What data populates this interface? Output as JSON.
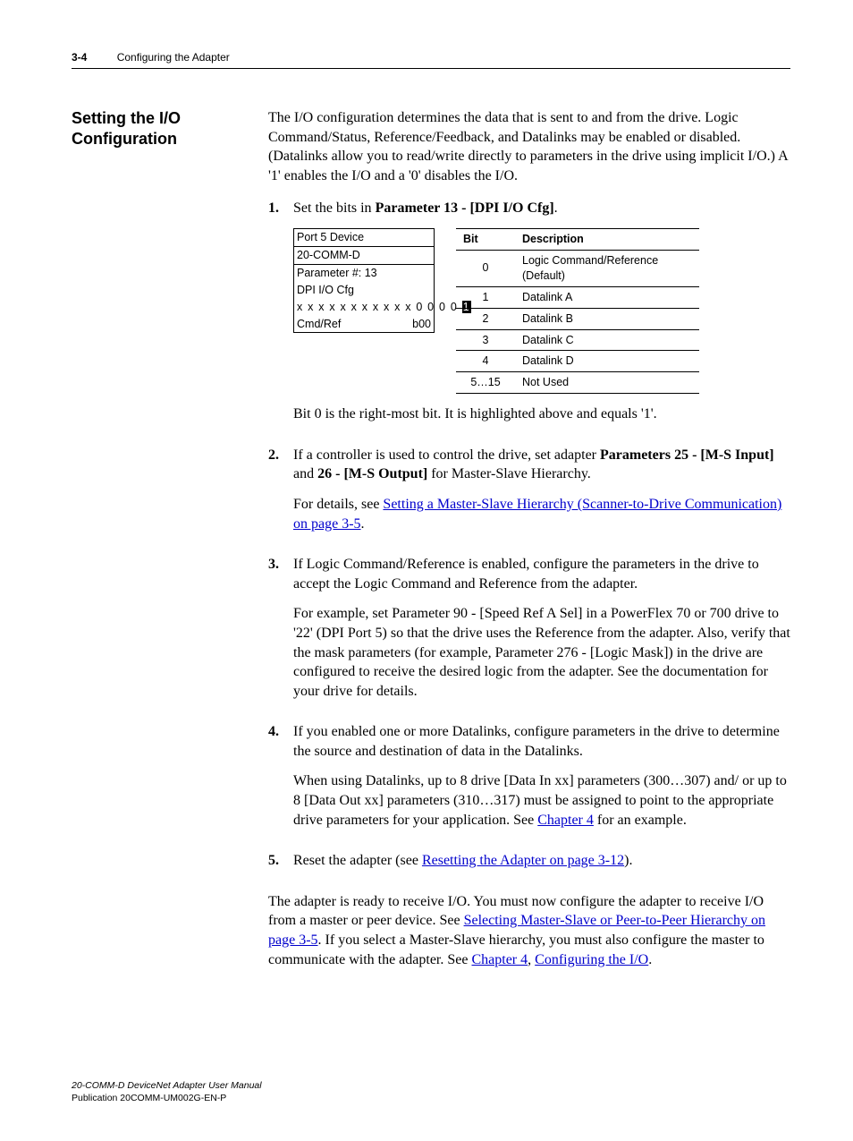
{
  "header": {
    "page": "3-4",
    "chapter": "Configuring the Adapter"
  },
  "side_heading": "Setting the I/O Configuration",
  "intro": "The I/O configuration determines the data that is sent to and from the drive. Logic Command/Status, Reference/Feedback, and Datalinks may be enabled or disabled. (Datalinks allow you to read/write directly to parameters in the drive using implicit I/O.) A '1' enables the I/O and a '0' disables the I/O.",
  "step1": {
    "num": "1.",
    "lead_a": "Set the bits in ",
    "lead_b": "Parameter 13 - [DPI I/O Cfg]",
    "lead_c": ".",
    "lcd": {
      "l1": "Port 5 Device",
      "l2": "20-COMM-D",
      "l3": "Parameter #: 13",
      "l4": "DPI I/O Cfg",
      "l5a": "x x x x x x x x x x x 0 0 0 0",
      "l5b": "1",
      "l6a": "Cmd/Ref",
      "l6b": "b00"
    },
    "table": {
      "h1": "Bit",
      "h2": "Description",
      "rows": [
        {
          "b": "0",
          "d": "Logic Command/Reference (Default)"
        },
        {
          "b": "1",
          "d": "Datalink A"
        },
        {
          "b": "2",
          "d": "Datalink B"
        },
        {
          "b": "3",
          "d": "Datalink C"
        },
        {
          "b": "4",
          "d": "Datalink D"
        },
        {
          "b": "5…15",
          "d": "Not Used"
        }
      ]
    },
    "after": "Bit 0 is the right-most bit. It is highlighted above and equals '1'."
  },
  "step2": {
    "num": "2.",
    "a": "If a controller is used to control the drive, set adapter ",
    "b": "Parameters 25 - [M-S Input]",
    "c": " and ",
    "d": "26 - [M-S Output]",
    "e": " for Master-Slave Hierarchy.",
    "f": "For details, see ",
    "link": "Setting a Master-Slave Hierarchy (Scanner-to-Drive Communication) on page 3-5",
    "g": "."
  },
  "step3": {
    "num": "3.",
    "p1": "If Logic Command/Reference is enabled, configure the parameters in the drive to accept the Logic Command and Reference from the adapter.",
    "p2": "For example, set Parameter 90 - [Speed Ref A Sel] in a PowerFlex 70 or 700 drive to '22' (DPI Port 5) so that the drive uses the Reference from the adapter. Also, verify that the mask parameters (for example, Parameter 276 - [Logic Mask]) in the drive are configured to receive the desired logic from the adapter. See the documentation for your drive for details."
  },
  "step4": {
    "num": "4.",
    "p1": "If you enabled one or more Datalinks, configure parameters in the drive to determine the source and destination of data in the Datalinks.",
    "p2a": "When using Datalinks, up to 8 drive [Data In xx] parameters (300…307) and/ or up to 8 [Data Out xx] parameters (310…317) must be assigned to point to the appropriate drive parameters for your application. See ",
    "p2link": "Chapter 4",
    "p2b": " for an example."
  },
  "step5": {
    "num": "5.",
    "a": "Reset the adapter (see ",
    "link": "Resetting the Adapter on page 3-12",
    "b": ")."
  },
  "closing": {
    "a": "The adapter is ready to receive I/O. You must now configure the adapter to receive I/O from a master or peer device. See ",
    "link1": "Selecting Master-Slave or Peer-to-Peer Hierarchy on page 3-5",
    "b": ". If you select a Master-Slave hierarchy, you must also configure the master to communicate with the adapter. See ",
    "link2": "Chapter 4",
    "c": ", ",
    "link3": "Configuring the I/O",
    "d": "."
  },
  "footer": {
    "l1": "20-COMM-D DeviceNet Adapter User Manual",
    "l2": "Publication 20COMM-UM002G-EN-P"
  }
}
